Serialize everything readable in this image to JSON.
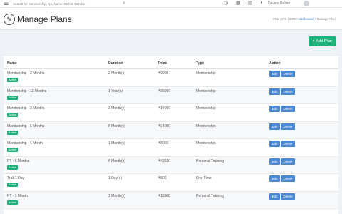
{
  "topbar": {
    "menu_icon": "☰",
    "search_placeholder": "Search for Membership, No, Name, Mobile Number",
    "search_icon": "⌕",
    "icons": [
      "clock-icon",
      "grid-icon",
      "calendar-icon"
    ],
    "device_label": "Device Online"
  },
  "header": {
    "title_icon": "✎",
    "title": "Manage Plans",
    "breadcrumb": {
      "prefix": "YOU ARE HERE:",
      "link": "Dashboard",
      "separator": "/",
      "current": "Manage Plan"
    }
  },
  "actions": {
    "add_plan_label": "+ Add Plan"
  },
  "table": {
    "columns": [
      "Name",
      "Duration",
      "Price",
      "Type",
      "Action"
    ],
    "rows": [
      {
        "name": "Membership - 2 Months",
        "status": "Active",
        "duration": "2 Month(s)",
        "price": "₹9000",
        "type": "Membership"
      },
      {
        "name": "Membership - 12 Months",
        "status": "Active",
        "duration": "1 Year(s)",
        "price": "₹35000",
        "type": "Membership"
      },
      {
        "name": "Membership - 3 Months",
        "status": "Active",
        "duration": "3 Month(s)",
        "price": "₹14000",
        "type": "Membership"
      },
      {
        "name": "Membership - 6 Months",
        "status": "Active",
        "duration": "6 Month(s)",
        "price": "₹24000",
        "type": "Membership"
      },
      {
        "name": "Membership - 1 Month",
        "status": "Active",
        "duration": "1 Month(s)",
        "price": "₹6000",
        "type": "Membership"
      },
      {
        "name": "PT - 6 Months",
        "status": "Active",
        "duration": "6 Month(s)",
        "price": "₹43660",
        "type": "Personal Training"
      },
      {
        "name": "Trail 1 Day",
        "status": "Active",
        "duration": "1 Day(s)",
        "price": "₹500",
        "type": "One Time"
      },
      {
        "name": "PT - 1 Month",
        "status": "Active",
        "duration": "1 Month(s)",
        "price": "₹11800",
        "type": "Personal Training"
      }
    ],
    "edit_label": "Edit",
    "delete_label": "Delete"
  },
  "colors": {
    "accent_green": "#1fb17a",
    "button_blue": "#4a88d3",
    "link_blue": "#3b8ad9"
  }
}
